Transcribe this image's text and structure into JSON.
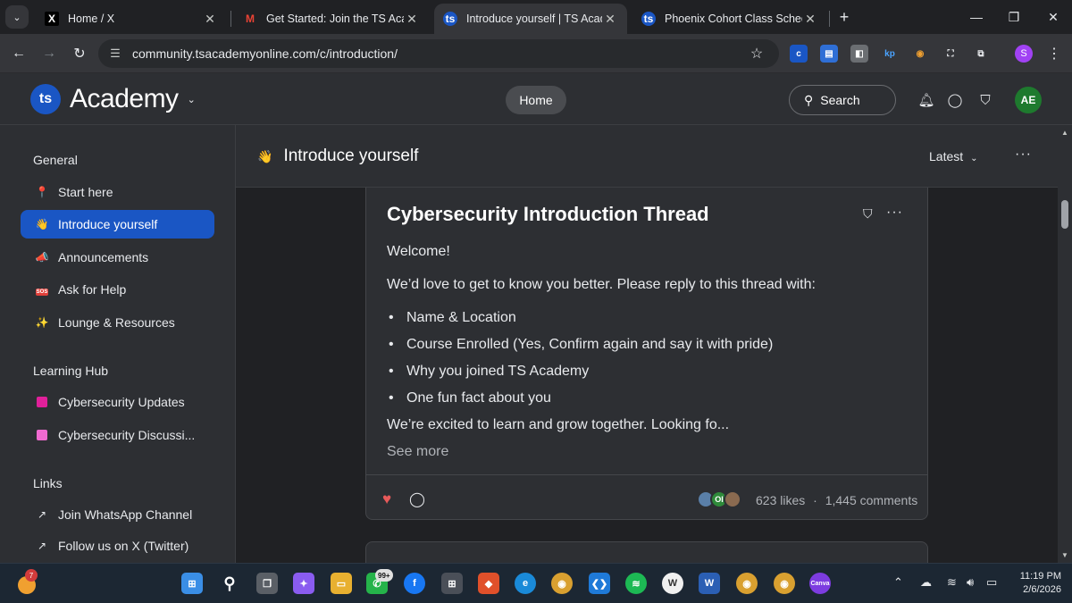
{
  "browser": {
    "tabs": [
      {
        "title": "Home / X",
        "favicon": "x-logo-icon"
      },
      {
        "title": "Get Started: Join the TS Academ",
        "favicon": "gmail-icon"
      },
      {
        "title": "Introduce yourself | TS Academ",
        "favicon": "ts-academy-icon",
        "active": true
      },
      {
        "title": "Phoenix Cohort Class Schedule",
        "favicon": "ts-academy-icon"
      }
    ],
    "url": "community.tsacademyonline.com/c/introduction/",
    "profile_initial": "S"
  },
  "header": {
    "brand_name": "Academy",
    "home_label": "Home",
    "search_label": "Search",
    "avatar_initials": "AE"
  },
  "sidebar": {
    "general_heading": "General",
    "general_items": [
      {
        "label": "Start here",
        "icon": "pin-icon"
      },
      {
        "label": "Introduce yourself",
        "icon": "wave-icon",
        "active": true
      },
      {
        "label": "Announcements",
        "icon": "megaphone-icon"
      },
      {
        "label": "Ask for Help",
        "icon": "sos-icon"
      },
      {
        "label": "Lounge & Resources",
        "icon": "sparkles-icon"
      }
    ],
    "learning_heading": "Learning Hub",
    "learning_items": [
      {
        "label": "Cybersecurity Updates",
        "color": "#e0209a"
      },
      {
        "label": "Cybersecurity Discussi...",
        "color": "#f06ad0"
      }
    ],
    "links_heading": "Links",
    "link_items": [
      {
        "label": "Join WhatsApp Channel",
        "icon": "external-link-icon"
      },
      {
        "label": "Follow us on X (Twitter)",
        "icon": "external-link-icon"
      }
    ]
  },
  "main": {
    "title": "Introduce yourself",
    "sort_label": "Latest",
    "post": {
      "title": "Cybersecurity Introduction Thread",
      "welcome": "Welcome!",
      "intro": "We’d love to get to know you better. Please reply to this thread with:",
      "bullets": [
        "Name & Location",
        "Course Enrolled (Yes, Confirm again and say it with pride)",
        "Why you joined TS Academy",
        "One fun fact about you"
      ],
      "closing": "We’re excited to learn and grow together. Looking fo...",
      "see_more": "See more",
      "avatar_initials": "OI",
      "likes": "623 likes",
      "separator": "·",
      "comments": "1,445 comments"
    }
  },
  "taskbar": {
    "weather_badge": "7",
    "whatsapp_badge": "99+",
    "time": "11:19 PM",
    "date": "2/6/2026"
  }
}
